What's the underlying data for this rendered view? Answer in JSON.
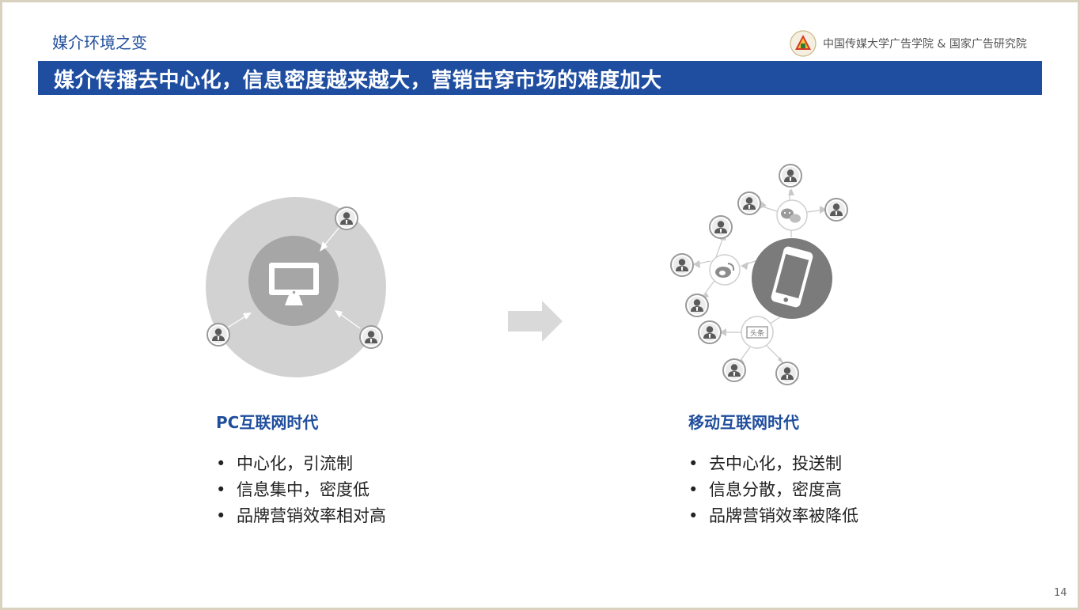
{
  "header": {
    "section_title": "媒介环境之变",
    "brand_text": "中国传媒大学广告学院 & 国家广告研究院",
    "banner_title": "媒介传播去中心化，信息密度越来越大，营销击穿市场的难度加大"
  },
  "left": {
    "era_title": "PC互联网时代",
    "bullets": [
      "中心化，引流制",
      "信息集中，密度低",
      "品牌营销效率相对高"
    ]
  },
  "right": {
    "era_title": "移动互联网时代",
    "bullets": [
      "去中心化，投送制",
      "信息分散，密度高",
      "品牌营销效率被降低"
    ],
    "toutiao_label": "头条"
  },
  "footer": {
    "page_number": "14"
  },
  "colors": {
    "accent_blue": "#1f4ea1",
    "gray_dark": "#7a7a7a",
    "gray_mid": "#a8a8a8",
    "gray_light": "#d0d0d0"
  }
}
